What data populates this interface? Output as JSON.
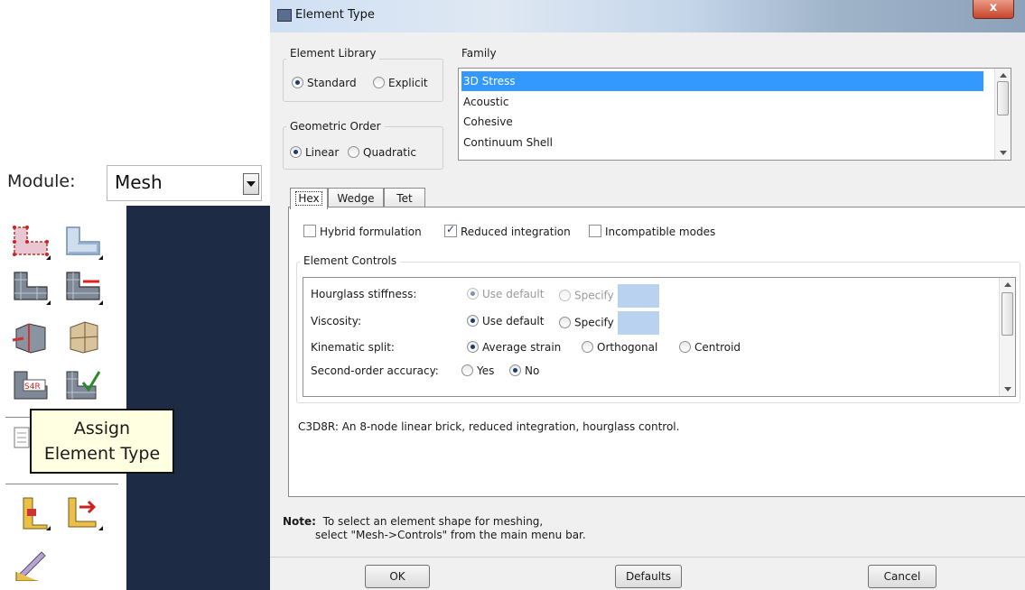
{
  "module": {
    "label": "Module:",
    "value": "Mesh"
  },
  "tooltip": {
    "line1": "Assign",
    "line2": "Element Type"
  },
  "dialog": {
    "title": "Element Type",
    "close_label": "x",
    "element_library": {
      "legend": "Element Library",
      "options": [
        {
          "label": "Standard",
          "selected": true
        },
        {
          "label": "Explicit",
          "selected": false
        }
      ]
    },
    "geometric_order": {
      "legend": "Geometric Order",
      "options": [
        {
          "label": "Linear",
          "selected": true
        },
        {
          "label": "Quadratic",
          "selected": false
        }
      ]
    },
    "family": {
      "legend": "Family",
      "items": [
        "3D Stress",
        "Acoustic",
        "Cohesive",
        "Continuum Shell"
      ],
      "selected": "3D Stress"
    },
    "tabs": [
      "Hex",
      "Wedge",
      "Tet"
    ],
    "active_tab": "Hex",
    "checks": [
      {
        "label": "Hybrid formulation",
        "checked": false
      },
      {
        "label": "Reduced integration",
        "checked": true
      },
      {
        "label": "Incompatible modes",
        "checked": false
      }
    ],
    "element_controls": {
      "legend": "Element Controls",
      "rows": [
        {
          "label": "Hourglass stiffness:",
          "opt1": "Use default",
          "opt2": "Specify"
        },
        {
          "label": "Viscosity:",
          "opt1": "Use default",
          "opt2": "Specify"
        },
        {
          "label": "Kinematic split:",
          "opt1": "Average strain",
          "opt2": "Orthogonal",
          "opt3": "Centroid"
        },
        {
          "label": "Second-order accuracy:",
          "opt1": "Yes",
          "opt2": "No"
        }
      ]
    },
    "description": "C3D8R:  An 8-node linear brick, reduced integration, hourglass control.",
    "note_label": "Note:",
    "note_line1": "To select an element shape for meshing,",
    "note_line2": "select \"Mesh->Controls\" from the main menu bar.",
    "buttons": {
      "ok": "OK",
      "defaults": "Defaults",
      "cancel": "Cancel"
    }
  }
}
